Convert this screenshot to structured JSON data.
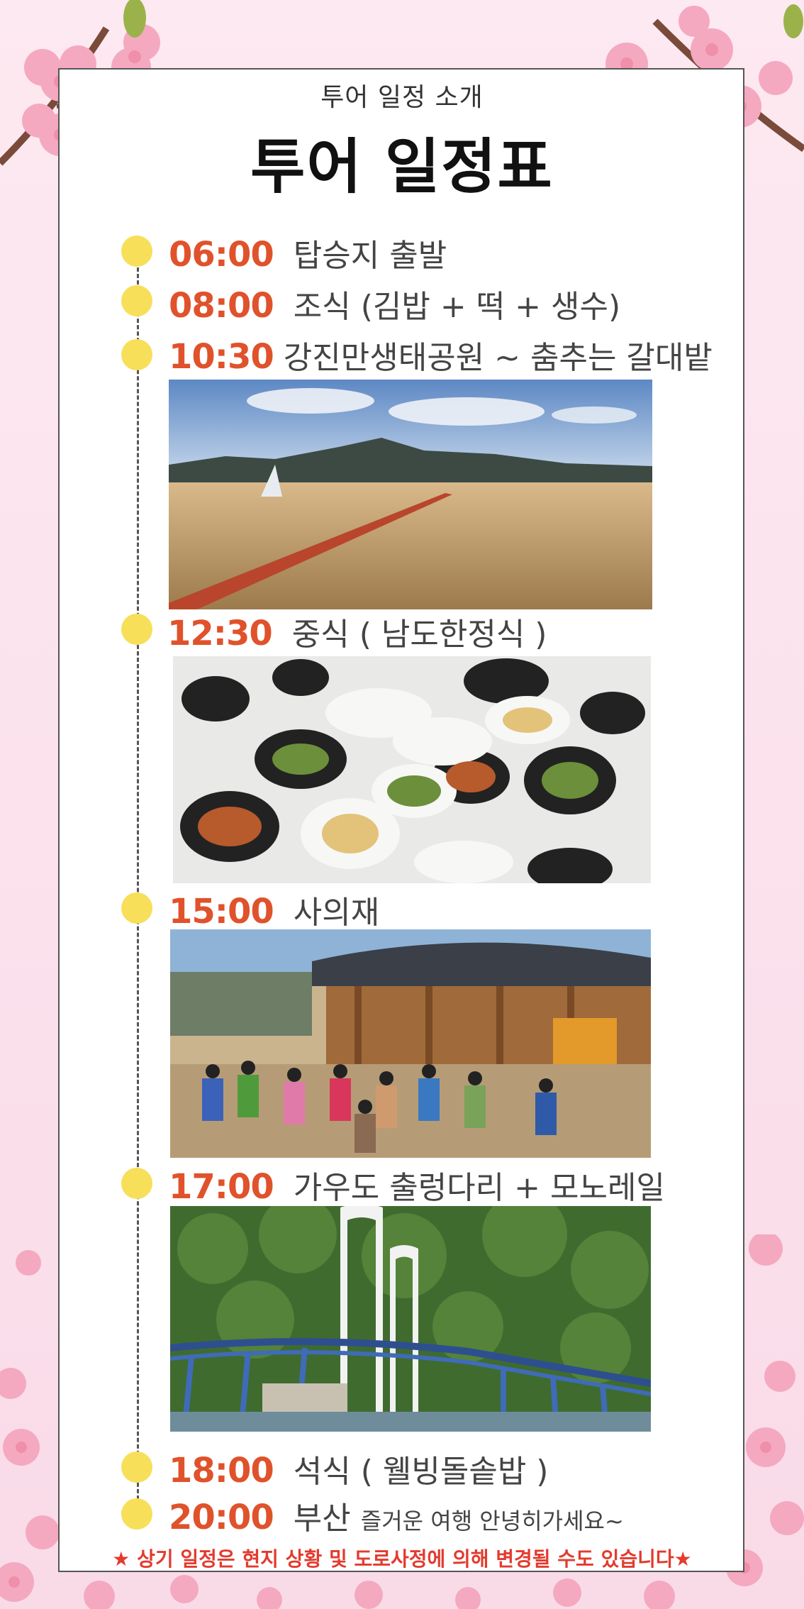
{
  "header": {
    "subtitle": "투어 일정 소개",
    "title": "투어 일정표"
  },
  "schedule": [
    {
      "time": "06:00",
      "label": "탑승지 출발"
    },
    {
      "time": "08:00",
      "label": "조식 (김밥 + 떡 + 생수)"
    },
    {
      "time": "10:30",
      "label": "강진만생태공원 ~ 춤추는 갈대밭",
      "photo": "reed-field-boardwalk"
    },
    {
      "time": "12:30",
      "label": "중식 ( 남도한정식 )",
      "photo": "korean-table-dishes"
    },
    {
      "time": "15:00",
      "label": "사의재",
      "photo": "traditional-dance-hanok"
    },
    {
      "time": "17:00",
      "label": "가우도 출렁다리 + 모노레일",
      "photo": "blue-suspension-bridge"
    },
    {
      "time": "18:00",
      "label": "석식 ( 웰빙돌솥밥 )"
    },
    {
      "time": "20:00",
      "label": "부산",
      "label_extra": "즐거운 여행 안녕히가세요~"
    }
  ],
  "notice": "★ 상기 일정은 현지 상황 및 도로사정에 의해  변경될 수도 있습니다★",
  "colors": {
    "time": "#e0522b",
    "dot": "#f7df5a",
    "notice": "#e33b2e",
    "background": "#fbe3ee",
    "blossom": "#f6b8cc"
  }
}
